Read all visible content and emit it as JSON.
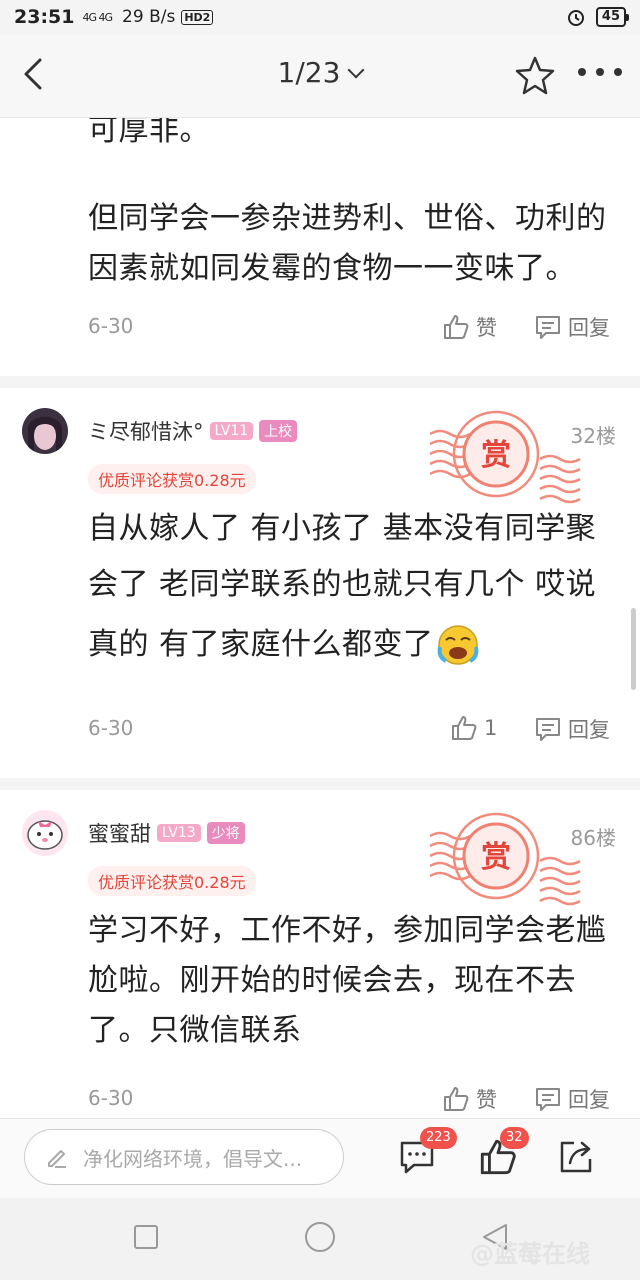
{
  "status_bar": {
    "time": "23:51",
    "signal": "4G 4G",
    "net_speed": "29 B/s",
    "hd": "HD2",
    "battery": "45"
  },
  "nav": {
    "title": "1/23"
  },
  "posts": [
    {
      "text_lines": [
        "可厚非。",
        "但同学会一参杂进势利、世俗、功利的",
        "因素就如同发霉的食物一一变味了。"
      ],
      "date": "6-30",
      "like_label": "赞",
      "reply_label": "回复"
    },
    {
      "username": "ミ尽郁惜沐°",
      "level": "LV11",
      "rank": "上校",
      "floor": "32楼",
      "reward": "优质评论获赏0.28元",
      "stamp_text": "赏",
      "text_lines": [
        "自从嫁人了 有小孩了 基本没有同学聚",
        "会了 老同学联系的也就只有几个 哎说",
        "真的 有了家庭什么都变了"
      ],
      "date": "6-30",
      "like_count": "1",
      "reply_label": "回复"
    },
    {
      "username": "蜜蜜甜",
      "level": "LV13",
      "rank": "少将",
      "floor": "86楼",
      "reward": "优质评论获赏0.28元",
      "stamp_text": "赏",
      "text_lines": [
        "学习不好，工作不好，参加同学会老尴",
        "尬啦。刚开始的时候会去，现在不去",
        "了。只微信联系"
      ],
      "date": "6-30",
      "like_label": "赞",
      "reply_label": "回复"
    }
  ],
  "bottom_bar": {
    "input_placeholder": "净化网络环境，倡导文...",
    "comments_badge": "223",
    "likes_badge": "32"
  },
  "watermark": "@蓝莓在线",
  "colors": {
    "accent_red": "#e4453a",
    "badge_red": "#f0524b",
    "level_pink": "#f5a9c8"
  }
}
